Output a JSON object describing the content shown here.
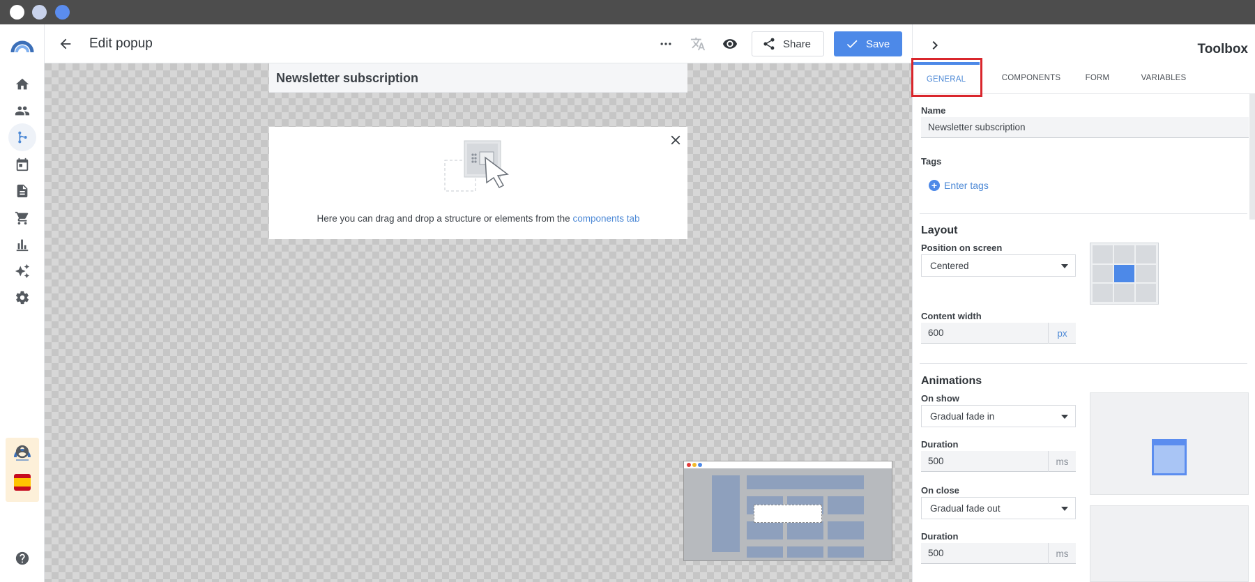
{
  "app": {
    "title": "Edit popup"
  },
  "sidebar": {
    "items": [
      {
        "name": "home"
      },
      {
        "name": "contacts"
      },
      {
        "name": "automation"
      },
      {
        "name": "calendar"
      },
      {
        "name": "documents"
      },
      {
        "name": "shop"
      },
      {
        "name": "analytics"
      },
      {
        "name": "ai"
      },
      {
        "name": "settings"
      }
    ]
  },
  "toolbar": {
    "share_label": "Share",
    "save_label": "Save"
  },
  "canvas": {
    "popup_name": "Newsletter subscription",
    "drop_text": "Here you can drag and drop a structure or elements from the ",
    "drop_link": "components tab"
  },
  "toolbox": {
    "title": "Toolbox",
    "tabs": [
      "GENERAL",
      "COMPONENTS",
      "FORM",
      "VARIABLES"
    ],
    "active_tab": "GENERAL",
    "name_label": "Name",
    "name_value": "Newsletter subscription",
    "tags_label": "Tags",
    "tags_add": "Enter tags",
    "layout_title": "Layout",
    "position_label": "Position on screen",
    "position_value": "Centered",
    "content_width_label": "Content width",
    "content_width_value": "600",
    "content_width_unit": "px",
    "animations_title": "Animations",
    "on_show_label": "On show",
    "on_show_value": "Gradual fade in",
    "duration_label": "Duration",
    "on_show_duration": "500",
    "duration_unit": "ms",
    "on_close_label": "On close",
    "on_close_value": "Gradual fade out",
    "on_close_duration": "500"
  },
  "colors": {
    "accent": "#4d89e8",
    "highlight_box": "#d9262c"
  }
}
